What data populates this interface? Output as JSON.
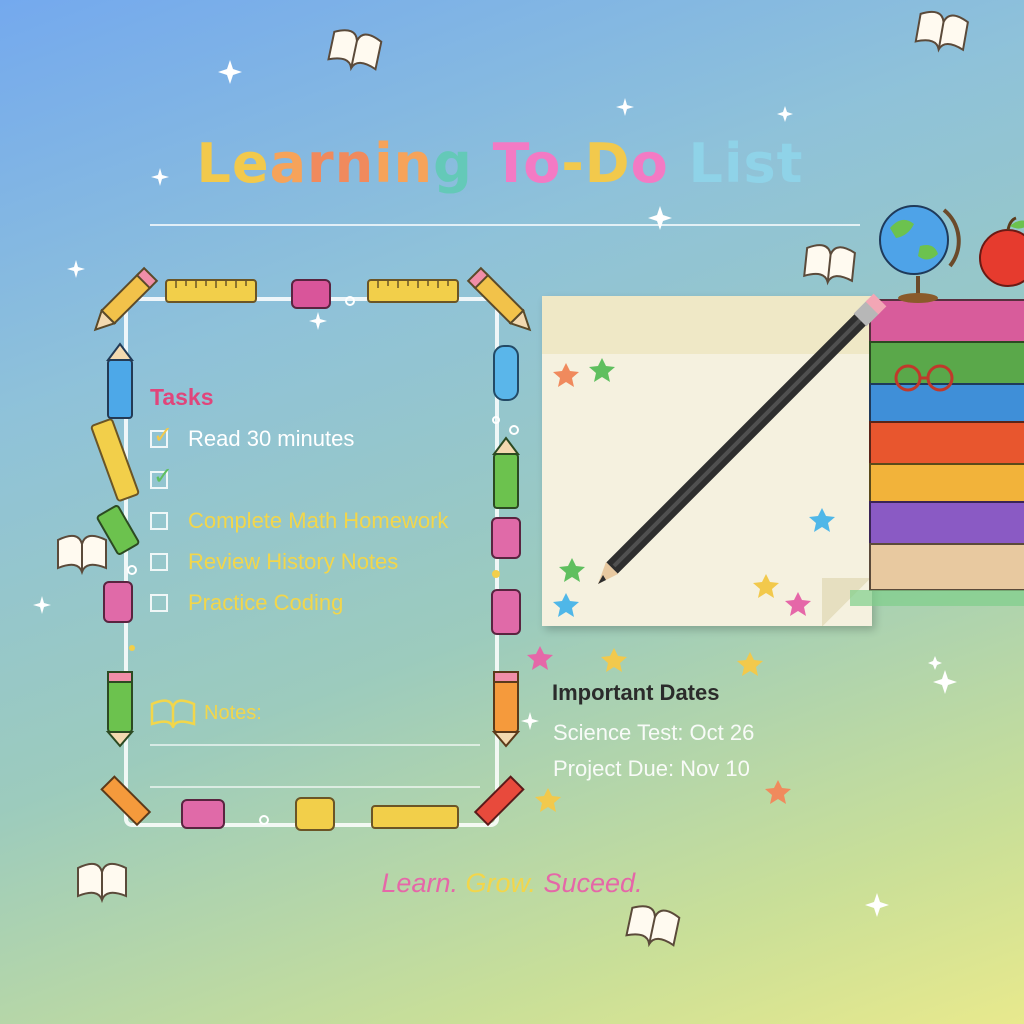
{
  "title": {
    "text": "Learning To-Do List",
    "letter_colors": [
      "#f2c94c",
      "#f2c94c",
      "#f6a35a",
      "#f08a5d",
      "#f08a5d",
      "#f6a35a",
      "#f6a35a",
      "#64c9b8",
      " ",
      "#f37ac4",
      "#f37ac4",
      "#f2c94c",
      "#f2c94c",
      "#f37ac4",
      " ",
      "#8fd3e8",
      "#8fd3e8",
      "#8fd3e8",
      "#8fd3e8"
    ]
  },
  "tasks": {
    "heading": "Tasks",
    "heading_color": "#e0457b",
    "items": [
      {
        "label": "Read 30 minutes",
        "checked": true,
        "check_color": "#f2c94c",
        "label_color": "#ffffff"
      },
      {
        "label": "",
        "checked": true,
        "check_color": "#5fbf5f",
        "label_color": "#f2d64b"
      },
      {
        "label": "Complete Math Homework",
        "checked": false,
        "check_color": "",
        "label_color": "#f2d64b"
      },
      {
        "label": "Review History Notes",
        "checked": false,
        "check_color": "",
        "label_color": "#f2d64b"
      },
      {
        "label": "Practice Coding",
        "checked": false,
        "check_color": "",
        "label_color": "#f2d64b"
      }
    ]
  },
  "notes": {
    "label": "Notes:",
    "icon": "book-icon",
    "color": "#f2d64b"
  },
  "important_dates": {
    "heading": "Important Dates",
    "items": [
      "Science Test: Oct 26",
      "Project Due: Nov 10"
    ]
  },
  "footer": {
    "parts": [
      {
        "text": "Learn.",
        "color": "#e567a8"
      },
      {
        "text": " Grow.",
        "color": "#f2d64b"
      },
      {
        "text": " Suceed.",
        "color": "#e567a8"
      }
    ]
  },
  "decor": {
    "icons": [
      "open-book-icon",
      "pencil-icon",
      "ruler-icon",
      "eraser-icon",
      "globe-icon",
      "apple-icon",
      "glasses-icon",
      "book-stack-icon",
      "sparkle-icon",
      "star-icon"
    ],
    "star_colors": [
      "#f08a5d",
      "#5fbf5f",
      "#4fb7e8",
      "#f2c94c",
      "#e567a8"
    ]
  }
}
